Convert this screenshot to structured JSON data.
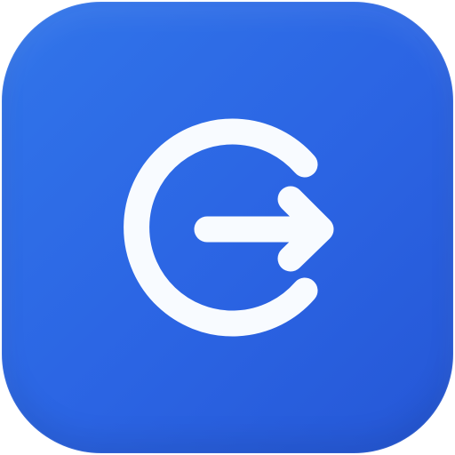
{
  "app_icon": {
    "semantic_name": "logout-icon",
    "background": {
      "gradient_start": "#3175ea",
      "gradient_end": "#2557d6"
    },
    "glyph_color": "#f8fbff"
  }
}
